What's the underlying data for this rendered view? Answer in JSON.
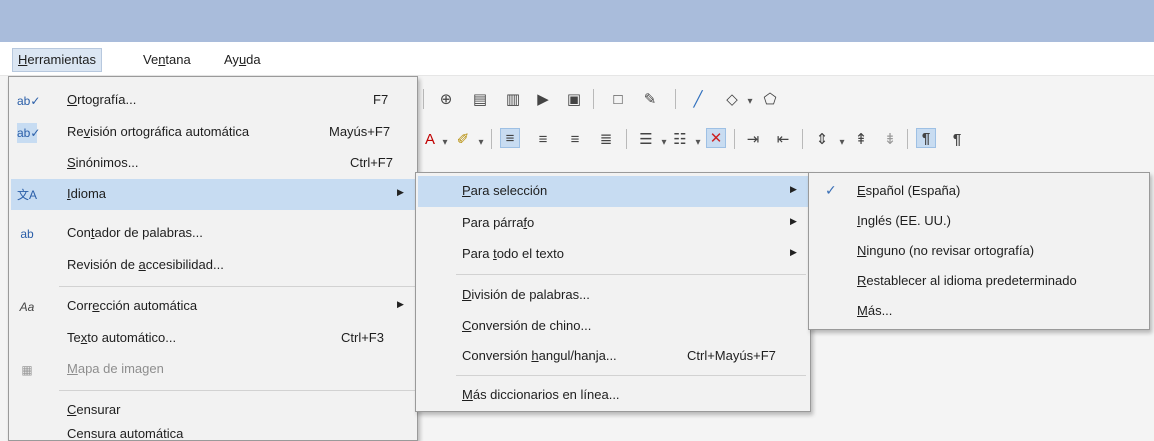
{
  "menubar": {
    "items": [
      {
        "pre": "",
        "u": "H",
        "post": "erramientas"
      },
      {
        "pre": "Ve",
        "u": "n",
        "post": "tana"
      },
      {
        "pre": "Ay",
        "u": "u",
        "post": "da"
      }
    ]
  },
  "tools_menu": {
    "items": [
      {
        "icon": "ab✓",
        "pre": "",
        "u": "O",
        "post": "rtografía...",
        "shortcut": "F7"
      },
      {
        "icon": "ab✓",
        "pre": "Re",
        "u": "v",
        "post": "isión ortográfica automática",
        "shortcut": "Mayús+F7"
      },
      {
        "icon": "",
        "pre": "",
        "u": "S",
        "post": "inónimos...",
        "shortcut": "Ctrl+F7"
      },
      {
        "icon": "文A",
        "pre": "",
        "u": "I",
        "post": "dioma",
        "shortcut": ""
      },
      {
        "icon": "ab",
        "pre": "Con",
        "u": "t",
        "post": "ador de palabras...",
        "shortcut": ""
      },
      {
        "icon": "",
        "pre": "Revisión de ",
        "u": "a",
        "post": "ccesibilidad...",
        "shortcut": ""
      },
      {
        "icon": "Aa",
        "pre": "Corr",
        "u": "e",
        "post": "cción automática",
        "shortcut": ""
      },
      {
        "icon": "",
        "pre": "Te",
        "u": "x",
        "post": "to automático...",
        "shortcut": "Ctrl+F3"
      },
      {
        "icon": "▦",
        "pre": "",
        "u": "M",
        "post": "apa de imagen",
        "shortcut": ""
      },
      {
        "icon": "",
        "pre": "",
        "u": "C",
        "post": "ensurar",
        "shortcut": ""
      },
      {
        "icon": "",
        "pre": "Censura automática",
        "u": "",
        "post": "",
        "shortcut": ""
      }
    ]
  },
  "language_menu": {
    "items": [
      {
        "pre": "",
        "u": "P",
        "post": "ara selección",
        "shortcut": ""
      },
      {
        "pre": "Para párra",
        "u": "f",
        "post": "o",
        "shortcut": ""
      },
      {
        "pre": "Para ",
        "u": "t",
        "post": "odo el texto",
        "shortcut": ""
      },
      {
        "pre": "",
        "u": "D",
        "post": "ivisión de palabras...",
        "shortcut": ""
      },
      {
        "pre": "",
        "u": "C",
        "post": "onversión de chino...",
        "shortcut": ""
      },
      {
        "pre": "Conversión ",
        "u": "h",
        "post": "angul/hanja...",
        "shortcut": "Ctrl+Mayús+F7"
      },
      {
        "pre": "",
        "u": "M",
        "post": "ás diccionarios en línea...",
        "shortcut": ""
      }
    ]
  },
  "selection_menu": {
    "items": [
      {
        "pre": "",
        "u": "E",
        "post": "spañol (España)",
        "checked": true
      },
      {
        "pre": "",
        "u": "I",
        "post": "nglés (EE. UU.)",
        "checked": false
      },
      {
        "pre": "",
        "u": "N",
        "post": "inguno (no revisar ortografía)",
        "checked": false
      },
      {
        "pre": "",
        "u": "R",
        "post": "establecer al idioma predeterminado",
        "checked": false
      },
      {
        "pre": "",
        "u": "M",
        "post": "ás...",
        "checked": false
      }
    ]
  },
  "glyphs": {
    "check": "✓",
    "submenu": "▶"
  },
  "colors": {
    "accent": "#c7dcf2",
    "titlebar": "#a9bcdb"
  }
}
